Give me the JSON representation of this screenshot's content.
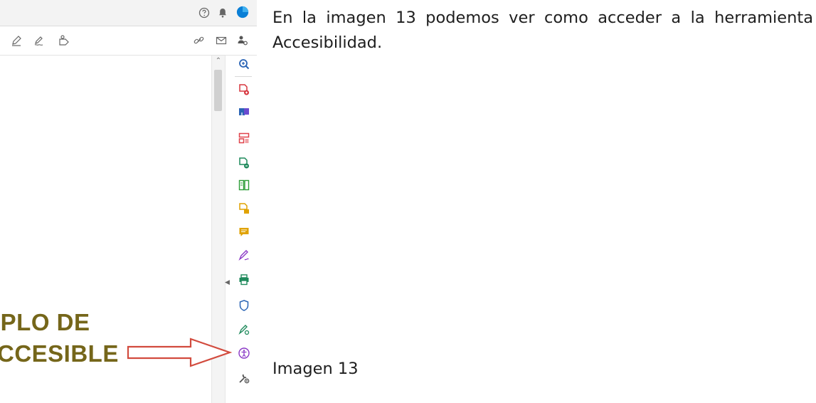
{
  "screenshot": {
    "right_rail_tools": [
      {
        "name": "zoom-icon",
        "color": "#2a64b5"
      },
      {
        "name": "create-pdf-icon",
        "color": "#d7373f"
      },
      {
        "name": "export-pdf-icon",
        "color": "#2a64b5"
      },
      {
        "name": "organize-pages-icon",
        "color": "#e0434b"
      },
      {
        "name": "combine-files-icon",
        "color": "#1f8a5c"
      },
      {
        "name": "edit-pdf-icon",
        "color": "#2d9d38"
      },
      {
        "name": "scan-ocr-icon",
        "color": "#e0a200"
      },
      {
        "name": "comment-icon",
        "color": "#e0a200"
      },
      {
        "name": "fill-sign-icon",
        "color": "#8a38c6"
      },
      {
        "name": "print-production-icon",
        "color": "#1f8a5c"
      },
      {
        "name": "protect-icon",
        "color": "#2a64b5"
      },
      {
        "name": "request-signature-icon",
        "color": "#1f8a5c"
      },
      {
        "name": "accessibility-icon",
        "color": "#8a38c6"
      },
      {
        "name": "more-tools-icon",
        "color": "#555555"
      }
    ],
    "document_text": [
      "IPLO DE",
      "CCESIBLE"
    ],
    "document_text_color": "#75661a",
    "annotation_color": "#d24b3e"
  },
  "paragraph": "En la imagen 13 podemos ver como acceder a la herramienta Accesibilidad.",
  "caption": "Imagen 13"
}
